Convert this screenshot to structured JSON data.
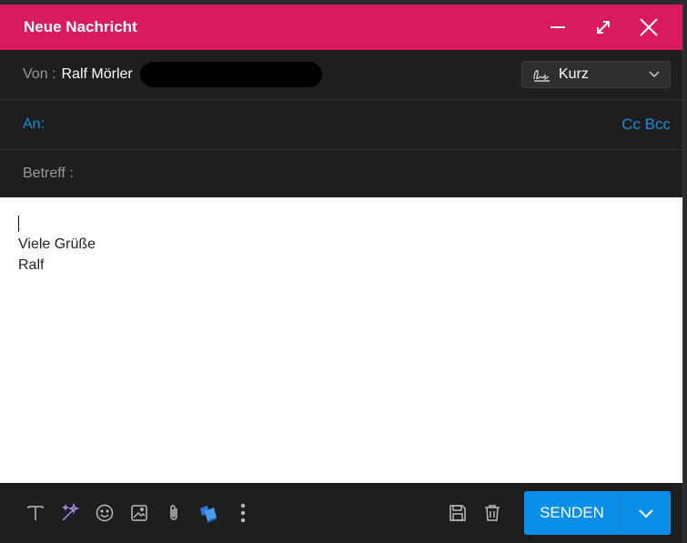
{
  "window": {
    "title": "Neue Nachricht"
  },
  "from": {
    "label": "Von :",
    "name": "Ralf Mörler"
  },
  "signature": {
    "selected": "Kurz"
  },
  "to": {
    "label": "An:",
    "cc_bcc": "Cc Bcc"
  },
  "subject": {
    "label": "Betreff :"
  },
  "body": {
    "lines": [
      "Viele Grüße",
      "Ralf"
    ]
  },
  "toolbar": {
    "icons": [
      "text-format-icon",
      "magic-wand-icon",
      "emoji-icon",
      "image-icon",
      "paperclip-icon",
      "app-icon",
      "more-vertical-icon",
      "save-icon",
      "trash-icon"
    ]
  },
  "send": {
    "label": "SENDEN"
  },
  "colors": {
    "accent": "#d81b60",
    "link": "#1a8fd6",
    "send": "#0a8fe8"
  }
}
